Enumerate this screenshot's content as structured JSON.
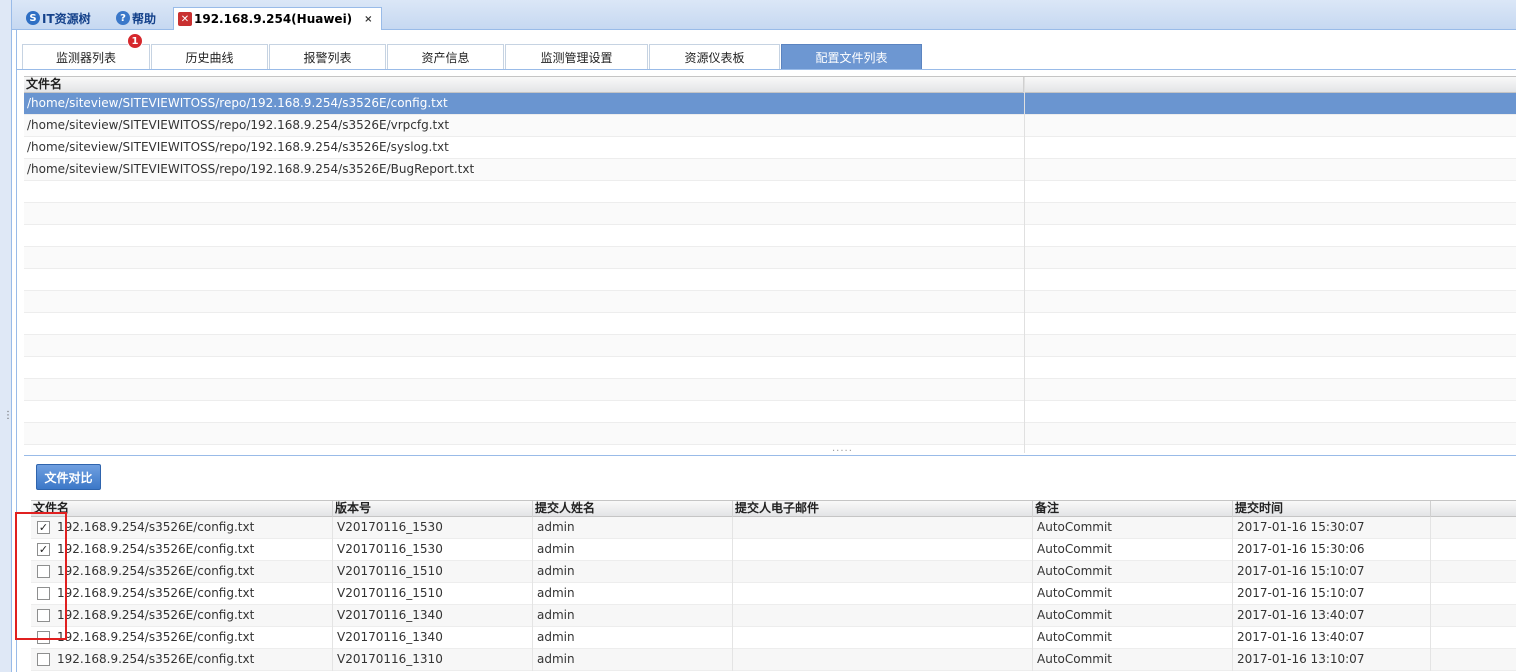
{
  "top_tabs": [
    {
      "label": "IT资源树",
      "icon": "tree-icon"
    },
    {
      "label": "帮助",
      "icon": "help-icon"
    },
    {
      "label": "192.168.9.254(Huawei)",
      "icon": "device-error-icon",
      "close": "×"
    }
  ],
  "inner_tabs": [
    "监测器列表",
    "历史曲线",
    "报警列表",
    "资产信息",
    "监测管理设置",
    "资源仪表板",
    "配置文件列表"
  ],
  "active_inner_tab": "配置文件列表",
  "notification_badge": "1",
  "file_list": {
    "header": "文件名",
    "rows": [
      "/home/siteview/SITEVIEWITOSS/repo/192.168.9.254/s3526E/config.txt",
      "/home/siteview/SITEVIEWITOSS/repo/192.168.9.254/s3526E/vrpcfg.txt",
      "/home/siteview/SITEVIEWITOSS/repo/192.168.9.254/s3526E/syslog.txt",
      "/home/siteview/SITEVIEWITOSS/repo/192.168.9.254/s3526E/BugReport.txt"
    ],
    "selected_index": 0
  },
  "compare_button": "文件对比",
  "versions": {
    "headers": [
      "文件名",
      "版本号",
      "提交人姓名",
      "提交人电子邮件",
      "备注",
      "提交时间"
    ],
    "rows": [
      {
        "checked": true,
        "file": "192.168.9.254/s3526E/config.txt",
        "version": "V20170116_1530",
        "name": "admin",
        "email": "",
        "note": "AutoCommit",
        "time": "2017-01-16 15:30:07"
      },
      {
        "checked": true,
        "file": "192.168.9.254/s3526E/config.txt",
        "version": "V20170116_1530",
        "name": "admin",
        "email": "",
        "note": "AutoCommit",
        "time": "2017-01-16 15:30:06"
      },
      {
        "checked": false,
        "file": "192.168.9.254/s3526E/config.txt",
        "version": "V20170116_1510",
        "name": "admin",
        "email": "",
        "note": "AutoCommit",
        "time": "2017-01-16 15:10:07"
      },
      {
        "checked": false,
        "file": "192.168.9.254/s3526E/config.txt",
        "version": "V20170116_1510",
        "name": "admin",
        "email": "",
        "note": "AutoCommit",
        "time": "2017-01-16 15:10:07"
      },
      {
        "checked": false,
        "file": "192.168.9.254/s3526E/config.txt",
        "version": "V20170116_1340",
        "name": "admin",
        "email": "",
        "note": "AutoCommit",
        "time": "2017-01-16 13:40:07"
      },
      {
        "checked": false,
        "file": "192.168.9.254/s3526E/config.txt",
        "version": "V20170116_1340",
        "name": "admin",
        "email": "",
        "note": "AutoCommit",
        "time": "2017-01-16 13:40:07"
      },
      {
        "checked": false,
        "file": "192.168.9.254/s3526E/config.txt",
        "version": "V20170116_1310",
        "name": "admin",
        "email": "",
        "note": "AutoCommit",
        "time": "2017-01-16 13:10:07"
      }
    ]
  },
  "colors": {
    "selected_row": "#6a95d0",
    "active_tab": "#6d97d2",
    "highlight_box": "#e02020",
    "badge": "#d6282d"
  }
}
